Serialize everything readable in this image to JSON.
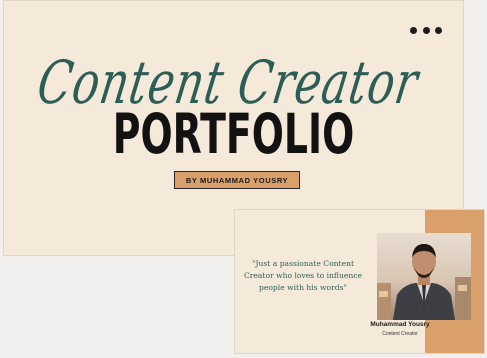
{
  "main_slide": {
    "script_title": "Content Creator",
    "title": "PORTFOLIO",
    "byline": "BY MUHAMMAD YOUSRY"
  },
  "toolbar": {
    "more_icon": "more-horizontal-icon"
  },
  "thumbnail_slide": {
    "quote": "\"Just a passionate Content Creator who loves to influence people with his words\"",
    "name": "Muhammad Yousry",
    "role": "Content Creator"
  },
  "colors": {
    "slide_background": "#f5eada",
    "accent_orange": "#d9a06b",
    "script_teal": "#2d5d57",
    "title_black": "#121212"
  }
}
